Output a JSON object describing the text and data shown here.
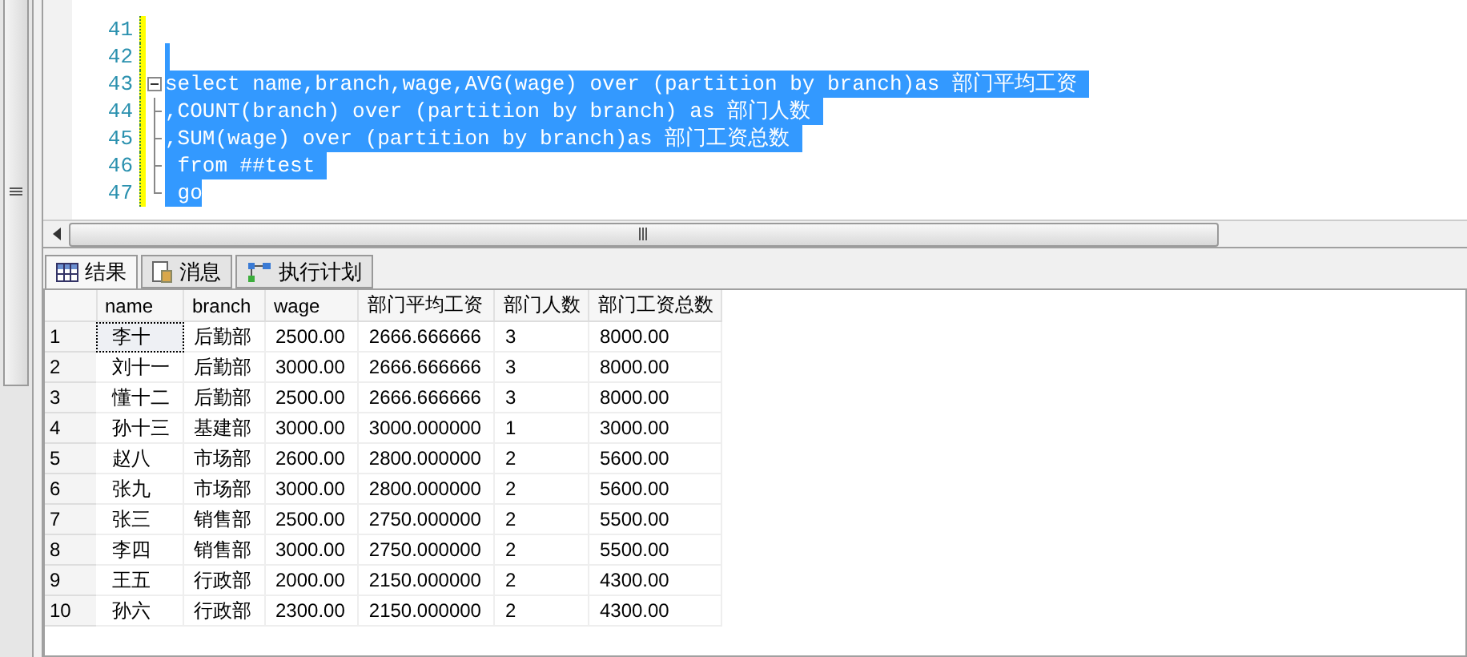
{
  "editor": {
    "lines": [
      {
        "number": "41",
        "selected": false,
        "kind": "none"
      },
      {
        "number": "42",
        "selected": true,
        "kind": "none"
      },
      {
        "number": "43",
        "text": "select name,branch,wage,AVG(wage) over (partition by branch)as 部门平均工资 ",
        "selected": true,
        "kind": "fold-start"
      },
      {
        "number": "44",
        "text": ",COUNT(branch) over (partition by branch) as 部门人数 ",
        "selected": true,
        "kind": "fold-line"
      },
      {
        "number": "45",
        "text": ",SUM(wage) over (partition by branch)as 部门工资总数 ",
        "selected": true,
        "kind": "fold-line"
      },
      {
        "number": "46",
        "text": " from ##test ",
        "selected": true,
        "kind": "fold-line"
      },
      {
        "number": "47",
        "text": " go",
        "selected": true,
        "kind": "fold-end"
      }
    ]
  },
  "result_tabs": [
    {
      "label": "结果",
      "selected": true
    },
    {
      "label": "消息",
      "selected": false
    },
    {
      "label": "执行计划",
      "selected": false
    }
  ],
  "grid": {
    "columns": [
      "name",
      "branch",
      "wage",
      "部门平均工资",
      "部门人数",
      "部门工资总数"
    ],
    "rows": [
      {
        "number": "1",
        "cells": [
          "李十",
          "后勤部",
          "2500.00",
          "2666.666666",
          "3",
          "8000.00"
        ],
        "focused": true
      },
      {
        "number": "2",
        "cells": [
          "刘十一",
          "后勤部",
          "3000.00",
          "2666.666666",
          "3",
          "8000.00"
        ],
        "focused": false
      },
      {
        "number": "3",
        "cells": [
          "懂十二",
          "后勤部",
          "2500.00",
          "2666.666666",
          "3",
          "8000.00"
        ],
        "focused": false
      },
      {
        "number": "4",
        "cells": [
          "孙十三",
          "基建部",
          "3000.00",
          "3000.000000",
          "1",
          "3000.00"
        ],
        "focused": false
      },
      {
        "number": "5",
        "cells": [
          "赵八",
          "市场部",
          "2600.00",
          "2800.000000",
          "2",
          "5600.00"
        ],
        "focused": false
      },
      {
        "number": "6",
        "cells": [
          "张九",
          "市场部",
          "3000.00",
          "2800.000000",
          "2",
          "5600.00"
        ],
        "focused": false
      },
      {
        "number": "7",
        "cells": [
          "张三",
          "销售部",
          "2500.00",
          "2750.000000",
          "2",
          "5500.00"
        ],
        "focused": false
      },
      {
        "number": "8",
        "cells": [
          "李四",
          "销售部",
          "3000.00",
          "2750.000000",
          "2",
          "5500.00"
        ],
        "focused": false
      },
      {
        "number": "9",
        "cells": [
          "王五",
          "行政部",
          "2000.00",
          "2150.000000",
          "2",
          "4300.00"
        ],
        "focused": false
      },
      {
        "number": "10",
        "cells": [
          "孙六",
          "行政部",
          "2300.00",
          "2150.000000",
          "2",
          "4300.00"
        ],
        "focused": false
      }
    ]
  }
}
